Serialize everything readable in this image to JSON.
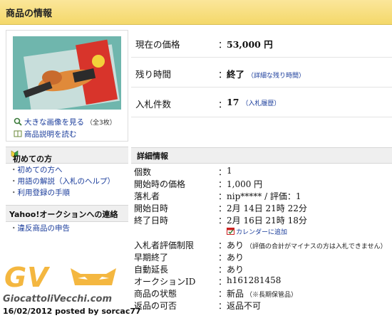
{
  "header": {
    "title": "商品の情報"
  },
  "image_panel": {
    "enlarge_label": "大きな画像を見る",
    "enlarge_note": "（全3枚）",
    "description_label": "商品説明を読む"
  },
  "sidebar": {
    "beginner": {
      "title": "初めての方",
      "items": [
        {
          "label": "初めての方へ"
        },
        {
          "label": "用語の解説（入札のヘルプ）"
        },
        {
          "label": "利用登録の手順"
        }
      ]
    },
    "contact": {
      "title": "Yahoo!オークションへの連絡",
      "items": [
        {
          "label": "違反商品の申告"
        }
      ]
    }
  },
  "summary": {
    "price": {
      "label": "現在の価格",
      "value": "53,000 円"
    },
    "time_left": {
      "label": "残り時間",
      "value": "終了",
      "link": "（詳細な残り時間）"
    },
    "bids": {
      "label": "入札件数",
      "value": "17",
      "link": "（入札履歴）"
    }
  },
  "details": {
    "title": "詳細情報",
    "quantity": {
      "label": "個数",
      "value": "1"
    },
    "start_price": {
      "label": "開始時の価格",
      "value": "1,000 円"
    },
    "winner": {
      "label": "落札者",
      "value": "nip***** / 評価：1"
    },
    "start_date": {
      "label": "開始日時",
      "value": "2月 14日 21時 22分"
    },
    "end_date": {
      "label": "終了日時",
      "value": "2月 16日 21時 18分"
    },
    "calendar_link": "カレンダーに追加",
    "rating_limit": {
      "label": "入札者評価制限",
      "value": "あり",
      "note": "（評価の合計がマイナスの方は入札できません）"
    },
    "early_end": {
      "label": "早期終了",
      "value": "あり"
    },
    "auto_extend": {
      "label": "自動延長",
      "value": "あり"
    },
    "auction_id": {
      "label": "オークションID",
      "value": "h161281458"
    },
    "condition": {
      "label": "商品の状態",
      "value": "新品",
      "note": "（※長期保管品）"
    },
    "returns": {
      "label": "返品の可否",
      "value": "返品不可"
    }
  },
  "watermark": {
    "logo": "GV",
    "site": "GiocattoliVecchi.com",
    "posted": "16/02/2012 posted by sorcac77"
  },
  "colors": {
    "header_bg": "#f4d86a",
    "link": "#1a3c9b",
    "watermark": "#f4b740",
    "thumb_bg": "#6fb6ad"
  }
}
